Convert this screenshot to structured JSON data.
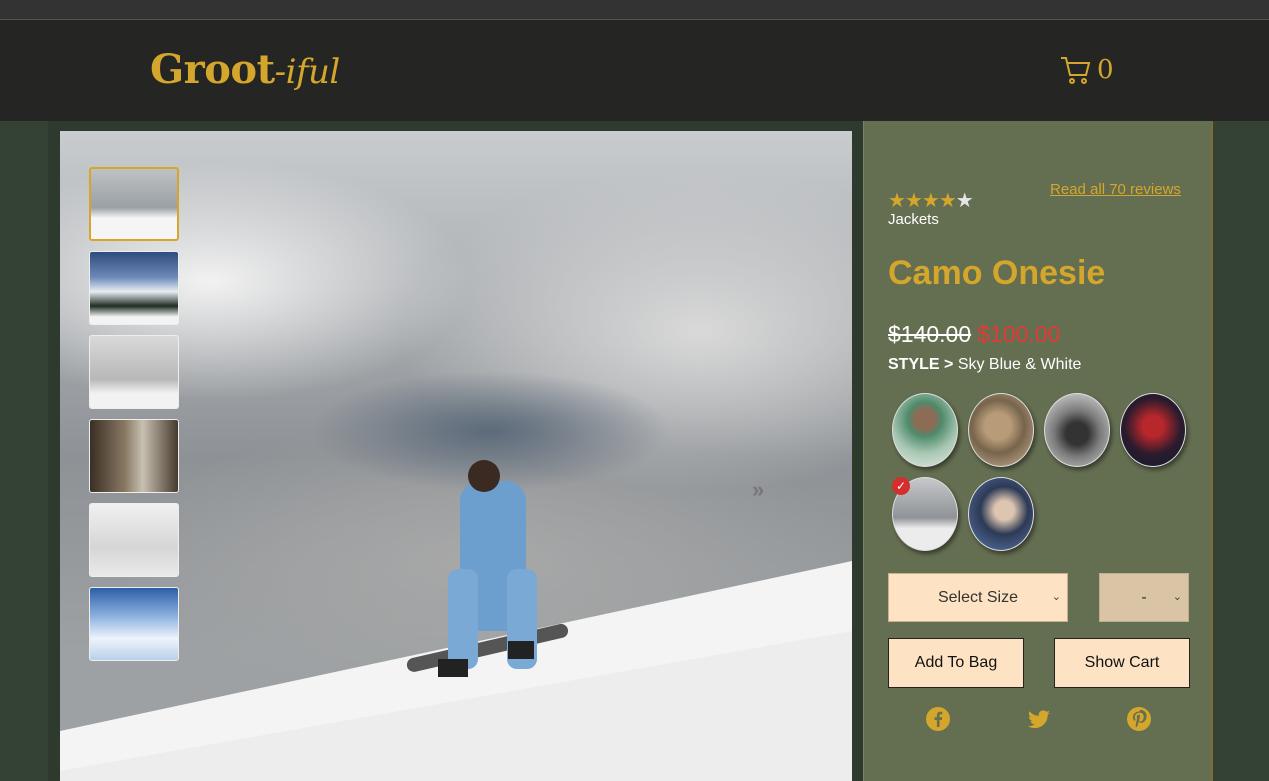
{
  "brand": {
    "name_main": "Groot",
    "name_suffix": "-iful"
  },
  "cart": {
    "count": "0"
  },
  "gallery": {
    "next_glyph": "»",
    "thumbnails": [
      "thumb-snowboarder",
      "thumb-mountain-forest",
      "thumb-snowy-street",
      "thumb-forest-person",
      "thumb-camo-person",
      "thumb-snowy-valley"
    ]
  },
  "product": {
    "rating": 4,
    "rating_max": 5,
    "category": "Jackets",
    "reviews_link": "Read all 70 reviews",
    "title": "Camo Onesie",
    "old_price": "$140.00",
    "new_price": "$100.00",
    "style_label": "STYLE >",
    "style_value": "Sky Blue & White",
    "size_select": "Select Size",
    "qty_select": "-",
    "add_to_bag": "Add To Bag",
    "show_cart": "Show Cart"
  },
  "colors": {
    "accent": "#d4a72c",
    "panel": "#646e51",
    "button": "#fde3c3",
    "sale": "#e53935"
  },
  "social": [
    "facebook-icon",
    "twitter-icon",
    "pinterest-icon"
  ]
}
